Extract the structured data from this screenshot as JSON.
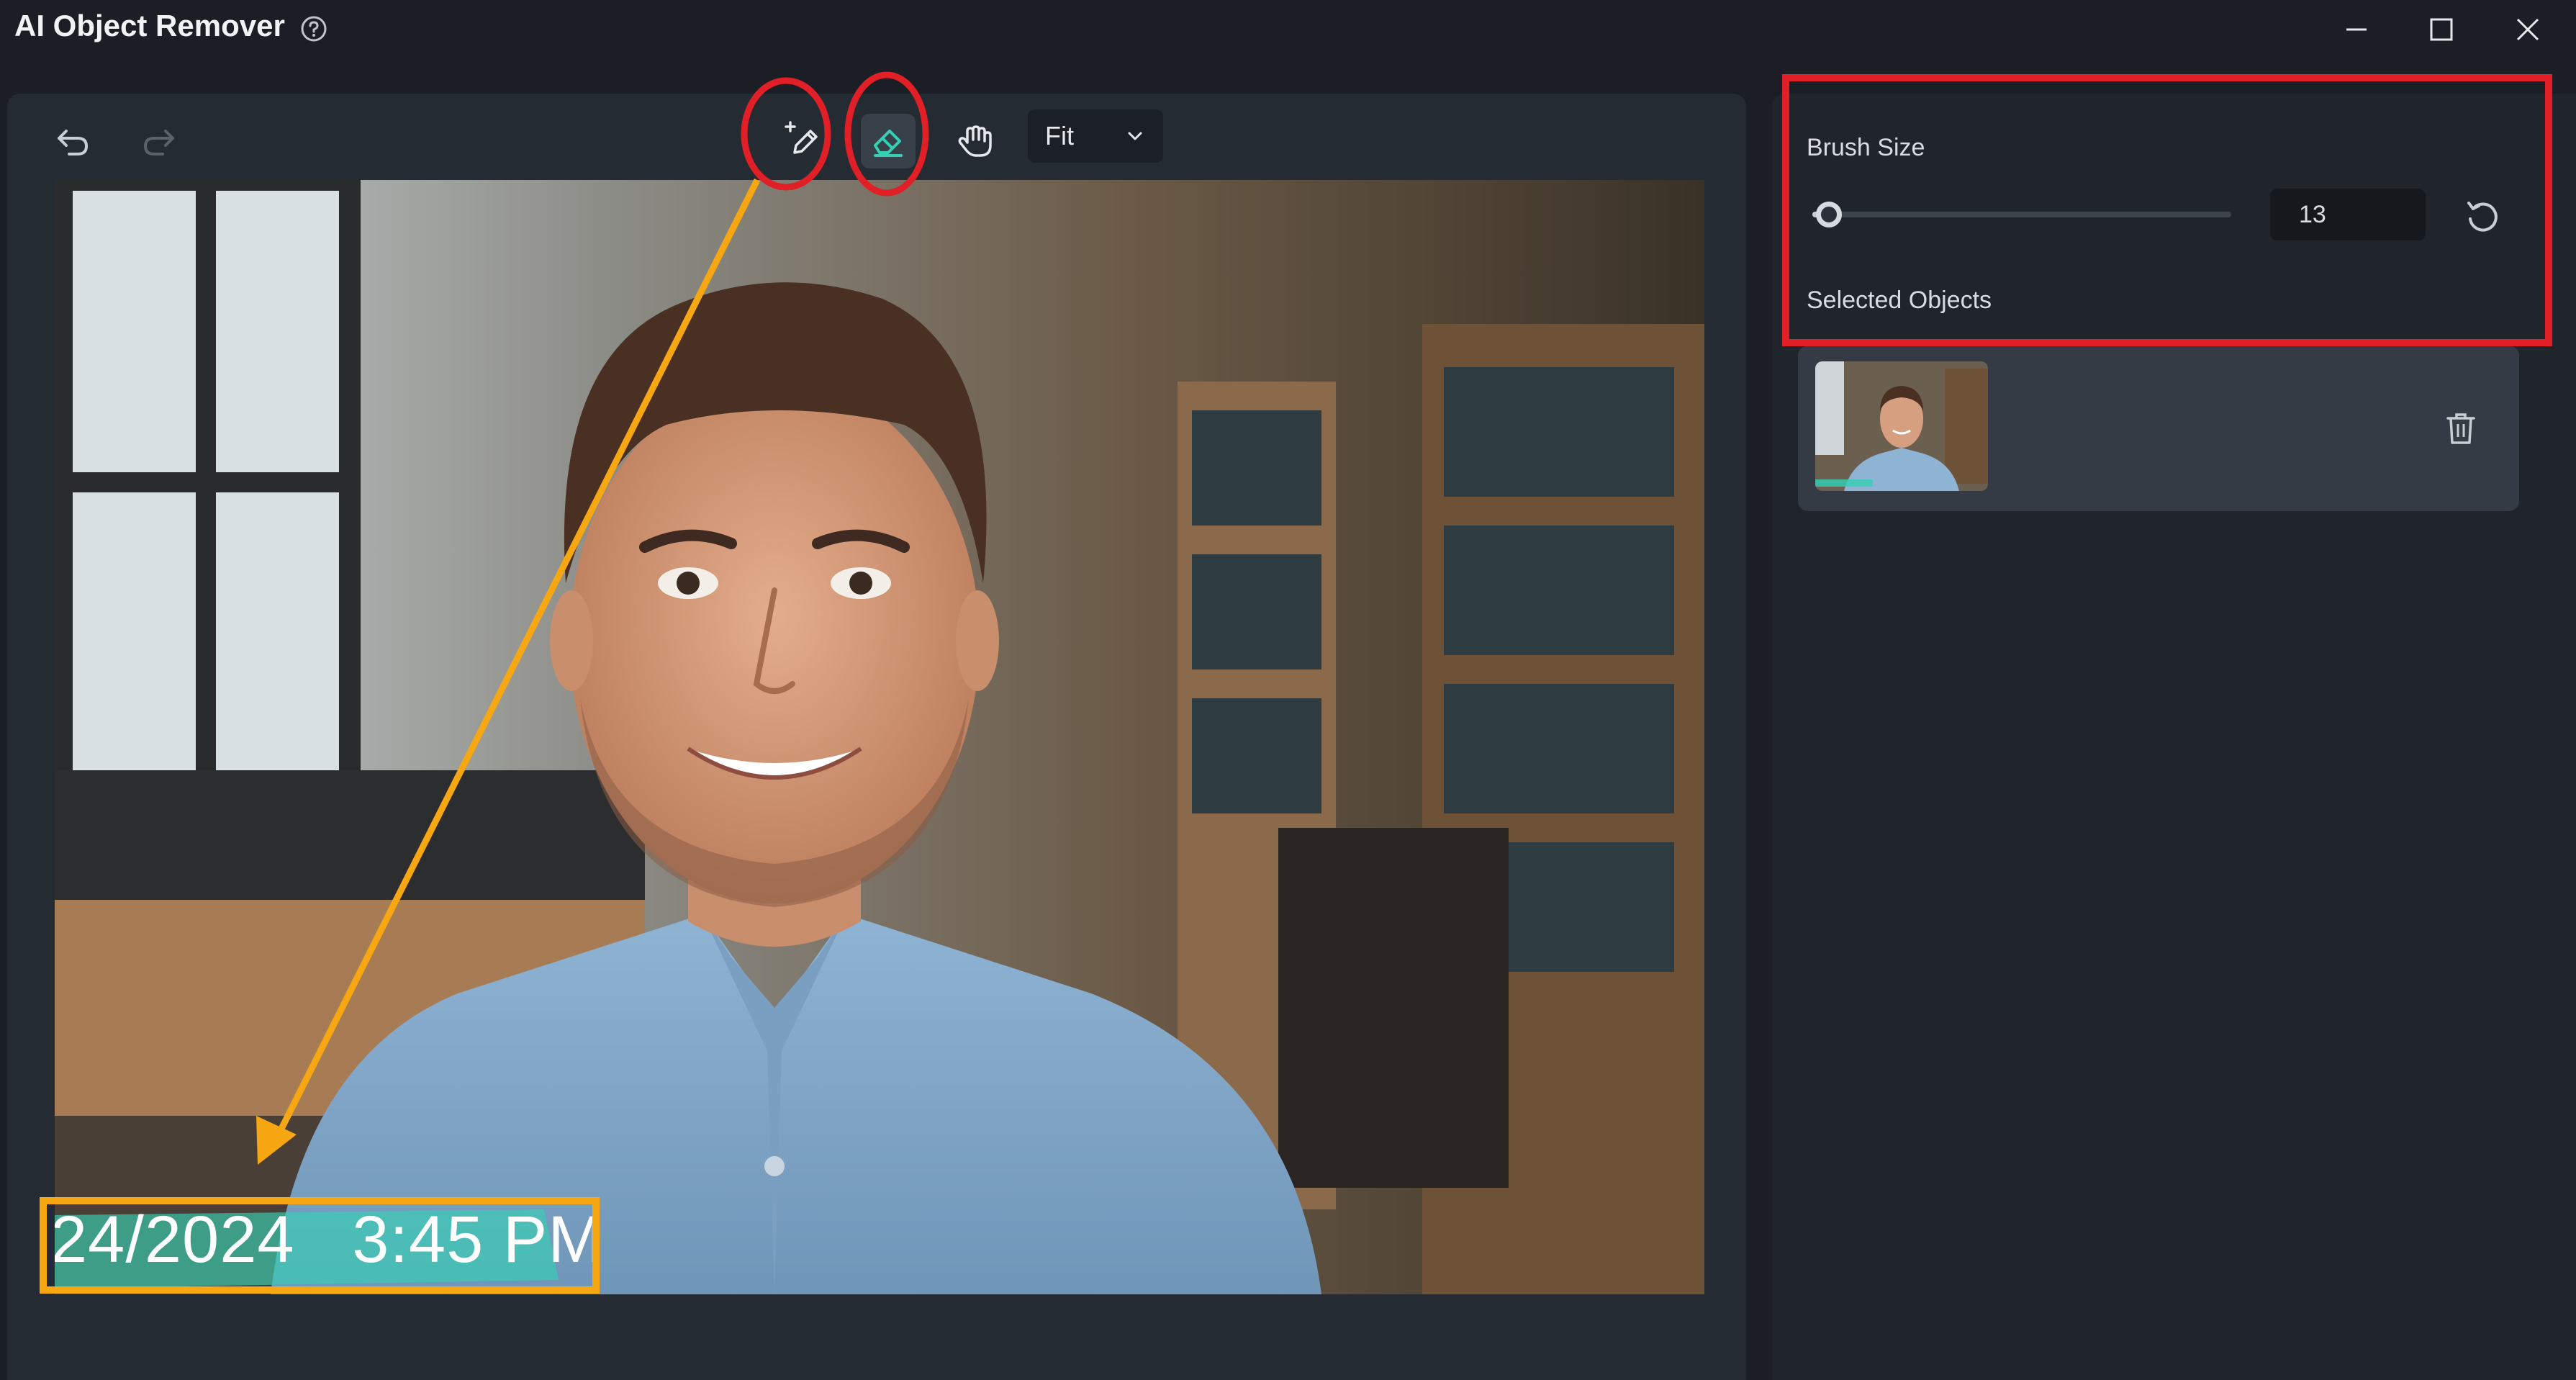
{
  "window": {
    "title": "AI Object Remover"
  },
  "toolbar": {
    "zoom_value": "Fit"
  },
  "image": {
    "timestamp_overlay": "24/2024   3:45 PM"
  },
  "side_panel": {
    "brush_size_label": "Brush Size",
    "brush_size_value": "13",
    "brush_size_fraction": 0.04,
    "selected_objects_label": "Selected Objects"
  },
  "colors": {
    "accent": "#35d0b4",
    "annotation_red": "#e01f26",
    "annotation_orange": "#f7a711"
  }
}
